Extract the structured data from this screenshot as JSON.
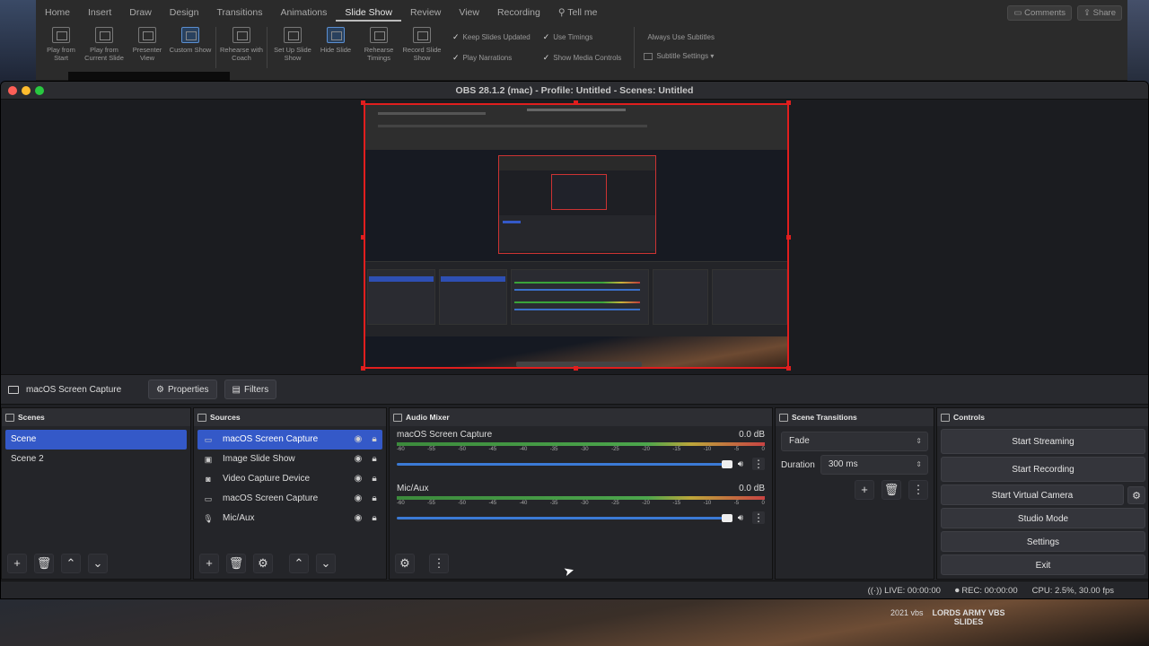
{
  "ppt": {
    "tabs": [
      "Home",
      "Insert",
      "Draw",
      "Design",
      "Transitions",
      "Animations",
      "Slide Show",
      "Review",
      "View",
      "Recording",
      "Tell me"
    ],
    "active_tab": "Slide Show",
    "comments": "Comments",
    "share": "Share",
    "buttons": [
      {
        "label": "Play from Start",
        "icon": "play-start-icon"
      },
      {
        "label": "Play from Current Slide",
        "icon": "play-current-icon"
      },
      {
        "label": "Presenter View",
        "icon": "presenter-view-icon"
      },
      {
        "label": "Custom Show",
        "icon": "custom-show-icon"
      },
      {
        "label": "Rehearse with Coach",
        "icon": "rehearse-coach-icon"
      },
      {
        "label": "Set Up Slide Show",
        "icon": "setup-slideshow-icon"
      },
      {
        "label": "Hide Slide",
        "icon": "hide-slide-icon"
      },
      {
        "label": "Rehearse Timings",
        "icon": "rehearse-timings-icon"
      },
      {
        "label": "Record Slide Show",
        "icon": "record-slideshow-icon"
      }
    ],
    "checks": {
      "keep_slides_updated": "Keep Slides Updated",
      "play_narrations": "Play Narrations",
      "use_timings": "Use Timings",
      "show_media_controls": "Show Media Controls",
      "always_use_subtitles": "Always Use Subtitles",
      "subtitle_settings": "Subtitle Settings"
    }
  },
  "obs": {
    "window_title": "OBS 28.1.2 (mac) - Profile: Untitled - Scenes: Untitled",
    "context": {
      "source_name": "macOS Screen Capture",
      "properties": "Properties",
      "filters": "Filters"
    },
    "scenes": {
      "title": "Scenes",
      "items": [
        "Scene",
        "Scene 2"
      ],
      "selected": 0
    },
    "sources": {
      "title": "Sources",
      "items": [
        {
          "label": "macOS Screen Capture",
          "icon": "monitor-icon",
          "selected": true
        },
        {
          "label": "Image Slide Show",
          "icon": "slideshow-icon",
          "selected": false
        },
        {
          "label": "Video Capture Device",
          "icon": "camera-icon",
          "selected": false
        },
        {
          "label": "macOS Screen Capture",
          "icon": "monitor-icon",
          "selected": false
        },
        {
          "label": "Mic/Aux",
          "icon": "microphone-icon",
          "selected": false
        }
      ]
    },
    "audio": {
      "title": "Audio Mixer",
      "ticks": [
        "-60",
        "-55",
        "-50",
        "-45",
        "-40",
        "-35",
        "-30",
        "-25",
        "-20",
        "-15",
        "-10",
        "-5",
        "0"
      ],
      "channels": [
        {
          "name": "macOS Screen Capture",
          "db": "0.0 dB"
        },
        {
          "name": "Mic/Aux",
          "db": "0.0 dB"
        }
      ]
    },
    "transitions": {
      "title": "Scene Transitions",
      "selected": "Fade",
      "duration_label": "Duration",
      "duration_value": "300 ms"
    },
    "controls": {
      "title": "Controls",
      "start_streaming": "Start Streaming",
      "start_recording": "Start Recording",
      "start_virtual_camera": "Start Virtual Camera",
      "studio_mode": "Studio Mode",
      "settings": "Settings",
      "exit": "Exit"
    },
    "status": {
      "live": "LIVE: 00:00:00",
      "rec": "REC: 00:00:00",
      "cpu": "CPU: 2.5%, 30.00 fps"
    }
  },
  "watermark": {
    "left": "2021 vbs",
    "right_line1": "LORDS ARMY VBS",
    "right_line2": "SLIDES"
  },
  "colors": {
    "selection_blue": "#3459c8",
    "preview_border_red": "#e01e1e",
    "meter_green": "#4ca64c",
    "volume_blue": "#3b7ad6"
  }
}
